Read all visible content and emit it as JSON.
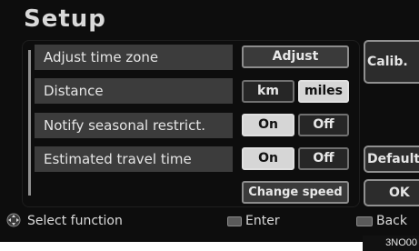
{
  "title": "Setup",
  "rows": [
    {
      "label": "Adjust time zone"
    },
    {
      "label": "Distance"
    },
    {
      "label": "Notify seasonal restrict."
    },
    {
      "label": "Estimated travel time"
    }
  ],
  "buttons": {
    "adjust": "Adjust",
    "km": "km",
    "miles": "miles",
    "notify_on": "On",
    "notify_off": "Off",
    "travel_on": "On",
    "travel_off": "Off",
    "change_speed": "Change speed",
    "calib": "Calib.",
    "default": "Default",
    "ok": "OK"
  },
  "footer": {
    "select": "Select function",
    "enter": "Enter",
    "back": "Back"
  },
  "code": "3NO00",
  "icons": {
    "select": "joystick-icon",
    "enter": "enter-icon",
    "back": "back-icon"
  }
}
